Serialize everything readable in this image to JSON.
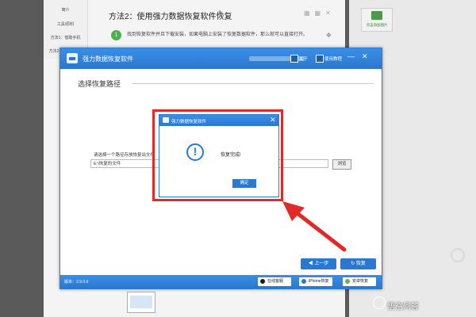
{
  "doc": {
    "title": "方法2：使用强力数据恢复软件恢复",
    "outline": [
      "简介",
      "工具/原料",
      "方法1：借助手机",
      "方法2：使用强力..."
    ],
    "step_number": "1",
    "step_text": "找到恢复软件并且下载安装，如果电脑上安装了恢复数据软件，那么就可以直接打开。",
    "side_widget_label": "点击添加图片"
  },
  "app": {
    "title": "强力数据恢复软件",
    "about_label": "关于",
    "tutorial_label": "使用教程",
    "window_controls": "—✕",
    "section_title": "选择恢复路径",
    "path_label": "请选择一个路径存放恢复出文件",
    "path_value": "E:\\恢复的文件",
    "browse_label": "浏览",
    "prev_label": "上一步",
    "recover_label": "恢复",
    "version": "版本：2.9.0.0",
    "footer_buttons": {
      "qq": "在线客服",
      "iphone": "iPhone恢复",
      "android": "安卓恢复"
    }
  },
  "dialog": {
    "title": "强力数据恢复软件",
    "close_glyph": "✕",
    "icon_glyph": "!",
    "message": "恢复完成!",
    "ok_label": "确定"
  },
  "watermark": "悟空问答",
  "colors": {
    "accent": "#2a78cf",
    "highlight": "#e02a2a",
    "step_badge": "#4caf50"
  }
}
